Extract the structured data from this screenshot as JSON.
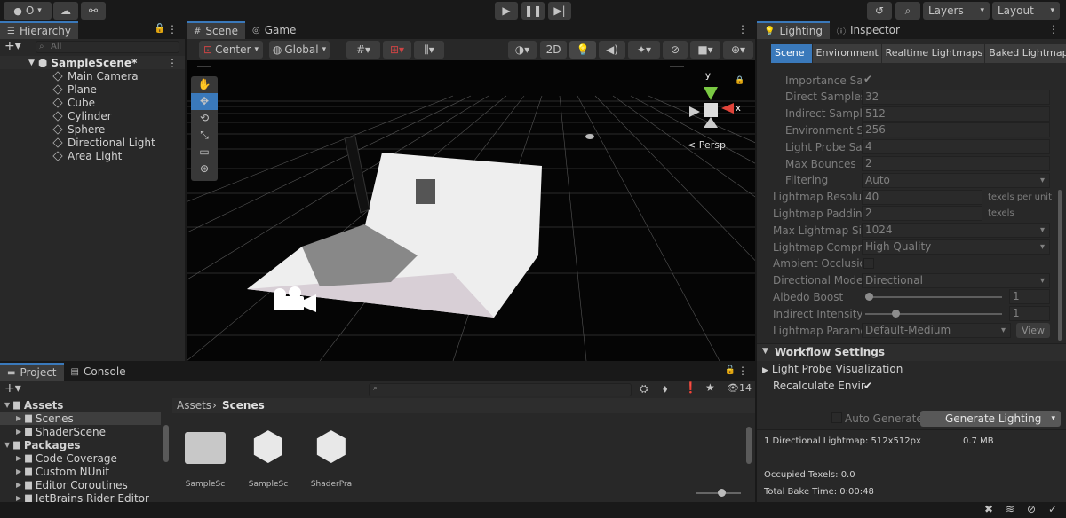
{
  "toolbar": {
    "account": "O",
    "layers": "Layers",
    "layout": "Layout"
  },
  "hierarchy": {
    "tab": "Hierarchy",
    "search_placeholder": "All",
    "scene": "SampleScene*",
    "items": [
      "Main Camera",
      "Plane",
      "Cube",
      "Cylinder",
      "Sphere",
      "Directional Light",
      "Area Light"
    ]
  },
  "scene_view": {
    "tab_scene": "Scene",
    "tab_game": "Game",
    "pivot": "Center",
    "space": "Global",
    "mode_2d": "2D",
    "persp": "< Persp",
    "axis_x": "x",
    "axis_y": "y"
  },
  "lighting": {
    "tab_lighting": "Lighting",
    "tab_inspector": "Inspector",
    "subtabs": [
      "Scene",
      "Environment",
      "Realtime Lightmaps",
      "Baked Lightmaps"
    ],
    "props": [
      {
        "label": "Importance Sampling",
        "value": "",
        "check": true
      },
      {
        "label": "Direct Samples",
        "value": "32"
      },
      {
        "label": "Indirect Samples",
        "value": "512"
      },
      {
        "label": "Environment Samples",
        "value": "256"
      },
      {
        "label": "Light Probe Sample Multiplier",
        "value": "4"
      },
      {
        "label": "Max Bounces",
        "value": "2"
      },
      {
        "label": "Filtering",
        "value": "Auto",
        "dropdown": true
      },
      {
        "label": "Lightmap Resolution",
        "value": "40",
        "unit": "texels per unit"
      },
      {
        "label": "Lightmap Padding",
        "value": "2",
        "unit": "texels"
      },
      {
        "label": "Max Lightmap Size",
        "value": "1024",
        "dropdown": true
      },
      {
        "label": "Lightmap Compression",
        "value": "High Quality",
        "dropdown": true
      },
      {
        "label": "Ambient Occlusion",
        "value": "",
        "checkbox": true
      },
      {
        "label": "Directional Mode",
        "value": "Directional",
        "dropdown": true
      },
      {
        "label": "Albedo Boost",
        "value": "1",
        "slider": 0.0
      },
      {
        "label": "Indirect Intensity",
        "value": "1",
        "slider": 0.2
      },
      {
        "label": "Lightmap Parameters",
        "value": "Default-Medium",
        "dropdown": true,
        "button": "View"
      }
    ],
    "workflow": "Workflow Settings",
    "probe_vis": "Light Probe Visualization",
    "recalc": "Recalculate Environment Lighting",
    "auto_generate": "Auto Generate",
    "generate": "Generate Lighting",
    "stats": {
      "lightmaps": "1 Directional Lightmap: 512x512px",
      "size": "0.7 MB",
      "occupied": "Occupied Texels: 0.0",
      "bake_time": "Total Bake Time: 0:00:48"
    }
  },
  "project": {
    "tab_project": "Project",
    "tab_console": "Console",
    "breadcrumb_root": "Assets",
    "breadcrumb_current": "Scenes",
    "count": "14",
    "tree": [
      {
        "label": "Assets",
        "level": 0,
        "bold": true
      },
      {
        "label": "Scenes",
        "level": 1,
        "selected": true
      },
      {
        "label": "ShaderScene",
        "level": 1
      },
      {
        "label": "Packages",
        "level": 0,
        "bold": true
      },
      {
        "label": "Code Coverage",
        "level": 1
      },
      {
        "label": "Custom NUnit",
        "level": 1
      },
      {
        "label": "Editor Coroutines",
        "level": 1
      },
      {
        "label": "JetBrains Rider Editor",
        "level": 1
      }
    ],
    "assets": [
      {
        "label": "SampleSc",
        "kind": "folder"
      },
      {
        "label": "SampleSc",
        "kind": "unity"
      },
      {
        "label": "ShaderPra",
        "kind": "unity"
      }
    ]
  }
}
